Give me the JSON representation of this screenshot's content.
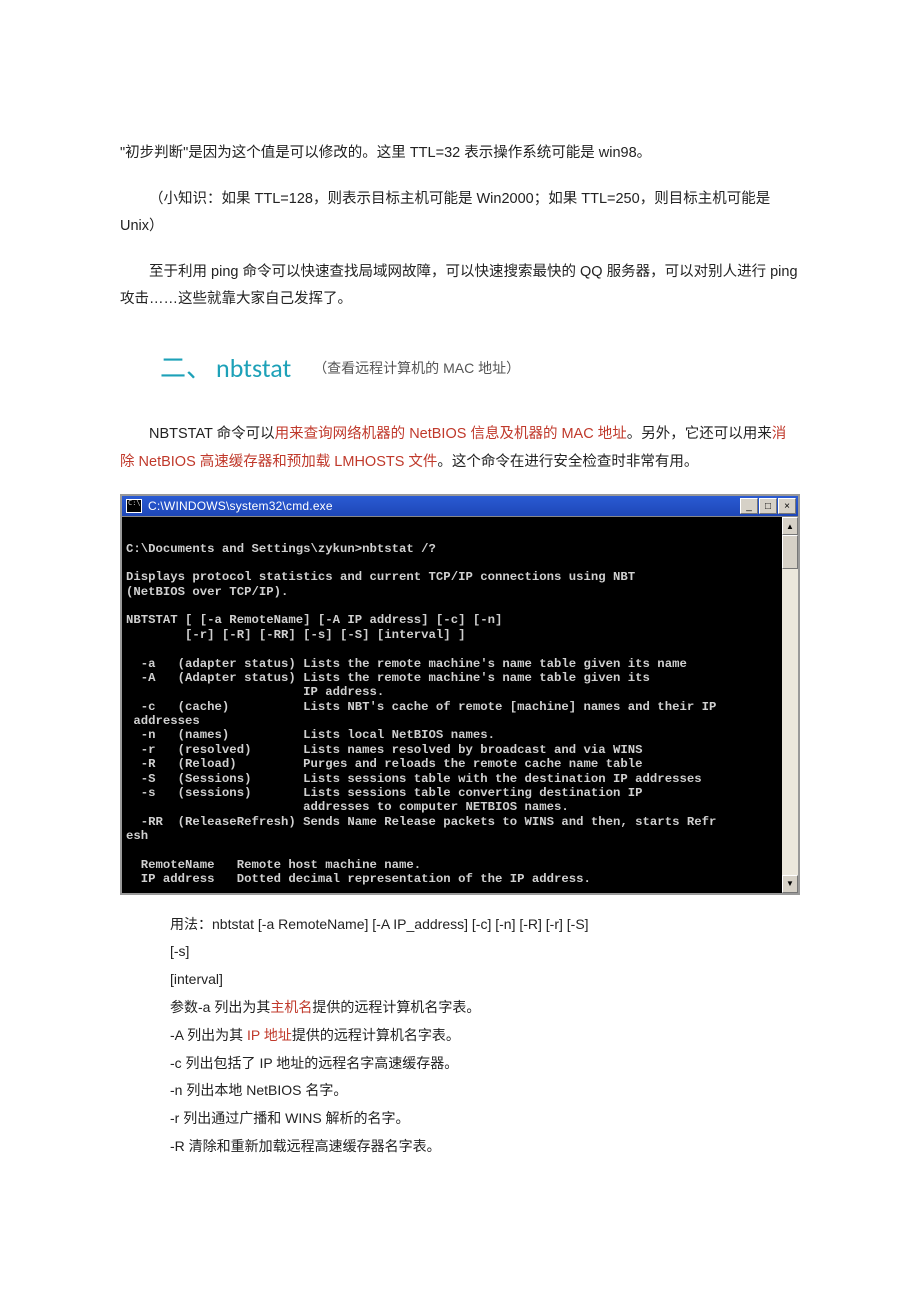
{
  "p1a": "\"初步判断\"是因为这个值是可以修改的。这里 TTL=32 表示操作系统可能是 win98。",
  "p2": "（小知识：如果 TTL=128，则表示目标主机可能是 Win2000；如果 TTL=250，则目标主机可能是 Unix）",
  "p3": "至于利用 ping 命令可以快速查找局域网故障，可以快速搜索最快的 QQ 服务器，可以对别人进行 ping 攻击……这些就靠大家自己发挥了。",
  "heading": {
    "num": "二、",
    "cmd": "nbtstat",
    "sub": "（查看远程计算机的 MAC 地址）"
  },
  "p4a": "NBTSTAT 命令可以",
  "p4red1": "用来查询网络机器的 NetBIOS 信息及机器的 MAC 地址",
  "p4b": "。另外，它还可以用来",
  "p4red2": "消除 NetBIOS 高速缓存器和预加载 LMHOSTS 文件",
  "p4c": "。这个命令在进行安全检查时非常有用。",
  "term": {
    "title": "C:\\WINDOWS\\system32\\cmd.exe",
    "min": "_",
    "max": "□",
    "close": "×",
    "body": "\nC:\\Documents and Settings\\zykun>nbtstat /?\n\nDisplays protocol statistics and current TCP/IP connections using NBT\n(NetBIOS over TCP/IP).\n\nNBTSTAT [ [-a RemoteName] [-A IP address] [-c] [-n]\n        [-r] [-R] [-RR] [-s] [-S] [interval] ]\n\n  -a   (adapter status) Lists the remote machine's name table given its name\n  -A   (Adapter status) Lists the remote machine's name table given its\n                        IP address.\n  -c   (cache)          Lists NBT's cache of remote [machine] names and their IP\n addresses\n  -n   (names)          Lists local NetBIOS names.\n  -r   (resolved)       Lists names resolved by broadcast and via WINS\n  -R   (Reload)         Purges and reloads the remote cache name table\n  -S   (Sessions)       Lists sessions table with the destination IP addresses\n  -s   (sessions)       Lists sessions table converting destination IP\n                        addresses to computer NETBIOS names.\n  -RR  (ReleaseRefresh) Sends Name Release packets to WINS and then, starts Refr\nesh\n\n  RemoteName   Remote host machine name.\n  IP address   Dotted decimal representation of the IP address."
  },
  "usage": {
    "u1": "用法：nbtstat [-a RemoteName] [-A IP_address] [-c] [-n] [-R] [-r] [-S]",
    "u2": "[-s]",
    "u3": "[interval]",
    "u4a": "参数-a 列出为其",
    "u4red": "主机名",
    "u4b": "提供的远程计算机名字表。",
    "u5a": "-A 列出为其 ",
    "u5red": "IP 地址",
    "u5b": "提供的远程计算机名字表。",
    "u6": "-c 列出包括了 IP 地址的远程名字高速缓存器。",
    "u7": "-n 列出本地 NetBIOS 名字。",
    "u8": "-r 列出通过广播和 WINS 解析的名字。",
    "u9": "-R 清除和重新加载远程高速缓存器名字表。"
  }
}
